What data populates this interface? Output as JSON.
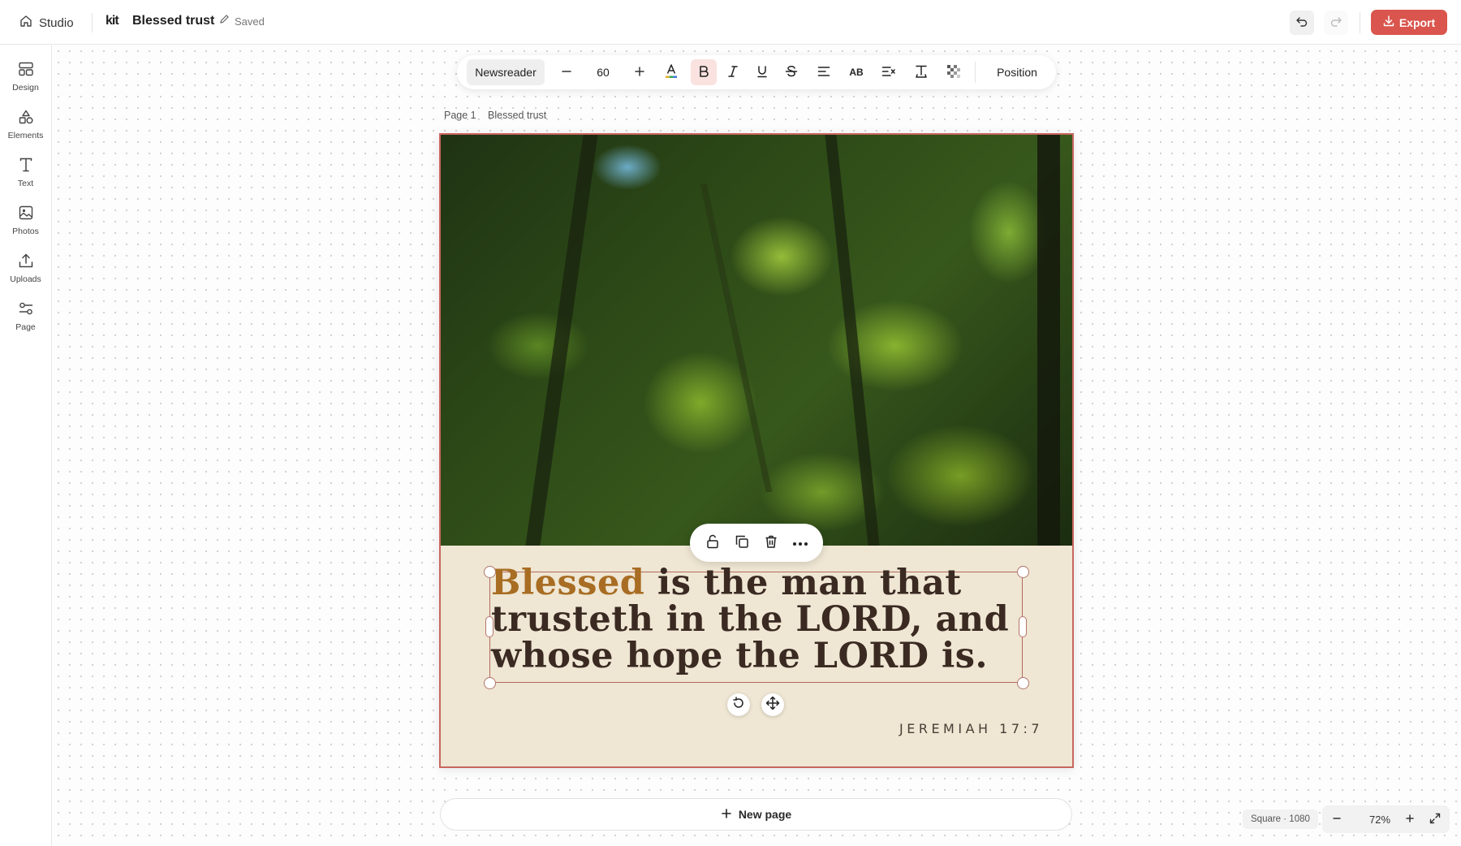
{
  "topbar": {
    "studio_label": "Studio",
    "logo_text": "kit",
    "doc_title": "Blessed trust",
    "save_status": "Saved",
    "export_label": "Export"
  },
  "sidebar": {
    "items": [
      {
        "label": "Design",
        "icon": "layout-icon"
      },
      {
        "label": "Elements",
        "icon": "shapes-icon"
      },
      {
        "label": "Text",
        "icon": "text-icon"
      },
      {
        "label": "Photos",
        "icon": "image-icon"
      },
      {
        "label": "Uploads",
        "icon": "upload-icon"
      },
      {
        "label": "Page",
        "icon": "sliders-icon"
      }
    ]
  },
  "text_toolbar": {
    "font_name": "Newsreader",
    "font_size": "60",
    "position_label": "Position"
  },
  "canvas": {
    "page_label": "Page 1",
    "page_name": "Blessed trust",
    "quote_first_word": "Blessed",
    "quote_rest": " is the man that trusteth in the LORD, and whose hope the LORD is.",
    "reference": "JEREMIAH 17:7",
    "new_page_label": "New page"
  },
  "footer": {
    "canvas_size": "Square · 1080",
    "zoom": "72%"
  },
  "colors": {
    "accent": "#d9554d",
    "page_background": "#efe6d3",
    "quote_text": "#3a2a22",
    "highlight_word": "#a86d23",
    "selection": "#b26a5e"
  }
}
